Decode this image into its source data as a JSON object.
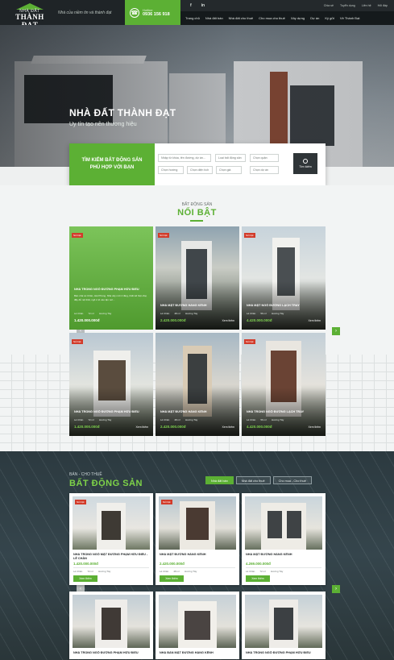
{
  "header": {
    "logo_line1": "NHÀ ĐẤT",
    "logo_line2": "THÀNH ĐẠT",
    "slogan": "Nhà của niềm tin và thành đạt",
    "hotline_label": "Hotline",
    "hotline_number": "0936 156 918",
    "social": [
      "f",
      "in"
    ],
    "top_links": [
      "Chia sẻ",
      "Tuyển dụng",
      "Liên hệ",
      "Hỏi đáp"
    ],
    "nav": [
      "Trang chủ",
      "Nhà đất bán",
      "Nhà đất cho thuê",
      "Cho mua cho thuê",
      "Xây dựng",
      "Dự án",
      "Ký gửi",
      "Về Thành Đạt"
    ]
  },
  "hero": {
    "title": "NHÀ ĐẤT THÀNH ĐẠT",
    "subtitle": "Uy tín tạo nên thương hiệu"
  },
  "search": {
    "title_line1": "TÌM KIẾM BẤT ĐỘNG SẢN",
    "title_line2": "PHÙ HỢP VỚI BẠN",
    "fields": [
      "Nhập từ khóa, tên đường, dự án...",
      "Loại bất động sản",
      "Chọn quận",
      "Chọn hướng",
      "Chọn diện tích",
      "Chọn giá",
      "Chọn dự án"
    ],
    "button": "Tìm kiếm"
  },
  "featured": {
    "eyebrow": "BẤT ĐỘNG SẢN",
    "heading": "NỔI BẬT",
    "badge": "Nổi bật",
    "more": "Xem thêm",
    "cards": [
      {
        "title": "NHÀ TRONG NGÕ ĐƯỜNG PHẠM HỮU ĐIỀU",
        "desc": "Bán nhà Lê Chân, Hải Phòng. Nhà xây mới 4 tầng, thiết kế hiện đại, đầy đủ nội thất, ngõ ô tô vào tận nơi...",
        "price": "1.420.000.000đ",
        "loc": "Lê Chân",
        "area": "72 m²",
        "dir": "Hướng Tây",
        "green": true
      },
      {
        "title": "NHÀ MẶT ĐƯỜNG HÀNG KÊNH",
        "price": "2.420.000.000đ",
        "loc": "Lê Chân",
        "area": "48 m²",
        "dir": "Hướng Tây"
      },
      {
        "title": "NHÀ MẶT NGÕ ĐƯỜNG LẠCH TRAY",
        "price": "4.420.000.000đ",
        "loc": "Lê Chân",
        "area": "56 m²",
        "dir": "Hướng Tây"
      },
      {
        "title": "NHÀ TRONG NGÕ ĐƯỜNG PHẠM HỮU ĐIỀU",
        "price": "1.420.000.000đ",
        "loc": "Lê Chân",
        "area": "72 m²",
        "dir": "Hướng Tây"
      },
      {
        "title": "NHÀ MẶT ĐƯỜNG HÀNG KÊNH",
        "price": "2.420.000.000đ",
        "loc": "Lê Chân",
        "area": "48 m²",
        "dir": "Hướng Tây"
      },
      {
        "title": "NHÀ TRONG NGÕ ĐƯỜNG LẠCH TRAY",
        "price": "4.420.000.000đ",
        "loc": "Lê Chân",
        "area": "56 m²",
        "dir": "Hướng Tây"
      }
    ]
  },
  "sales": {
    "eyebrow": "BÁN - CHO THUÊ",
    "heading": "BẤT ĐỘNG SẢN",
    "tabs": [
      "Nhà đất bán",
      "Nhà đất cho thuê",
      "Cho mua - Cho thuê"
    ],
    "badge": "Nổi bật",
    "button": "Xem thêm",
    "cards": [
      {
        "title": "NHÀ TRONG NGÕ MẶT ĐƯỜNG PHẠM HỮU ĐIỀU - LÊ CHÂN",
        "price": "1.420.000.000đ",
        "loc": "Lê Chân",
        "area": "72 m²",
        "dir": "Hướng Tây"
      },
      {
        "title": "NHÀ MẶT ĐƯỜNG HÀNG KÊNH",
        "price": "2.420.000.000đ",
        "loc": "Lê Chân",
        "area": "48 m²",
        "dir": "Hướng Tây"
      },
      {
        "title": "NHÀ MẶT ĐƯỜNG HÀNG KÊNH",
        "price": "4.269.000.000đ",
        "loc": "Lê Chân",
        "area": "72 m²",
        "dir": "Hướng Tây"
      },
      {
        "title": "NHÀ TRONG NGÕ ĐƯỜNG PHẠM HỮU ĐIỀU"
      },
      {
        "title": "NHÀ BÁN MẶT ĐƯỜNG HÀNG KÊNH"
      },
      {
        "title": "NHÀ TRONG NGÕ ĐƯỜNG PHẠM HỮU ĐIỀU"
      }
    ]
  },
  "colors": {
    "brand_green": "#5cb034",
    "badge_red": "#d23b2a",
    "dark": "#1f2427"
  },
  "icons": [
    "phone-icon",
    "facebook-icon",
    "linkedin-icon",
    "search-icon",
    "arrow-left-icon",
    "arrow-right-icon"
  ]
}
